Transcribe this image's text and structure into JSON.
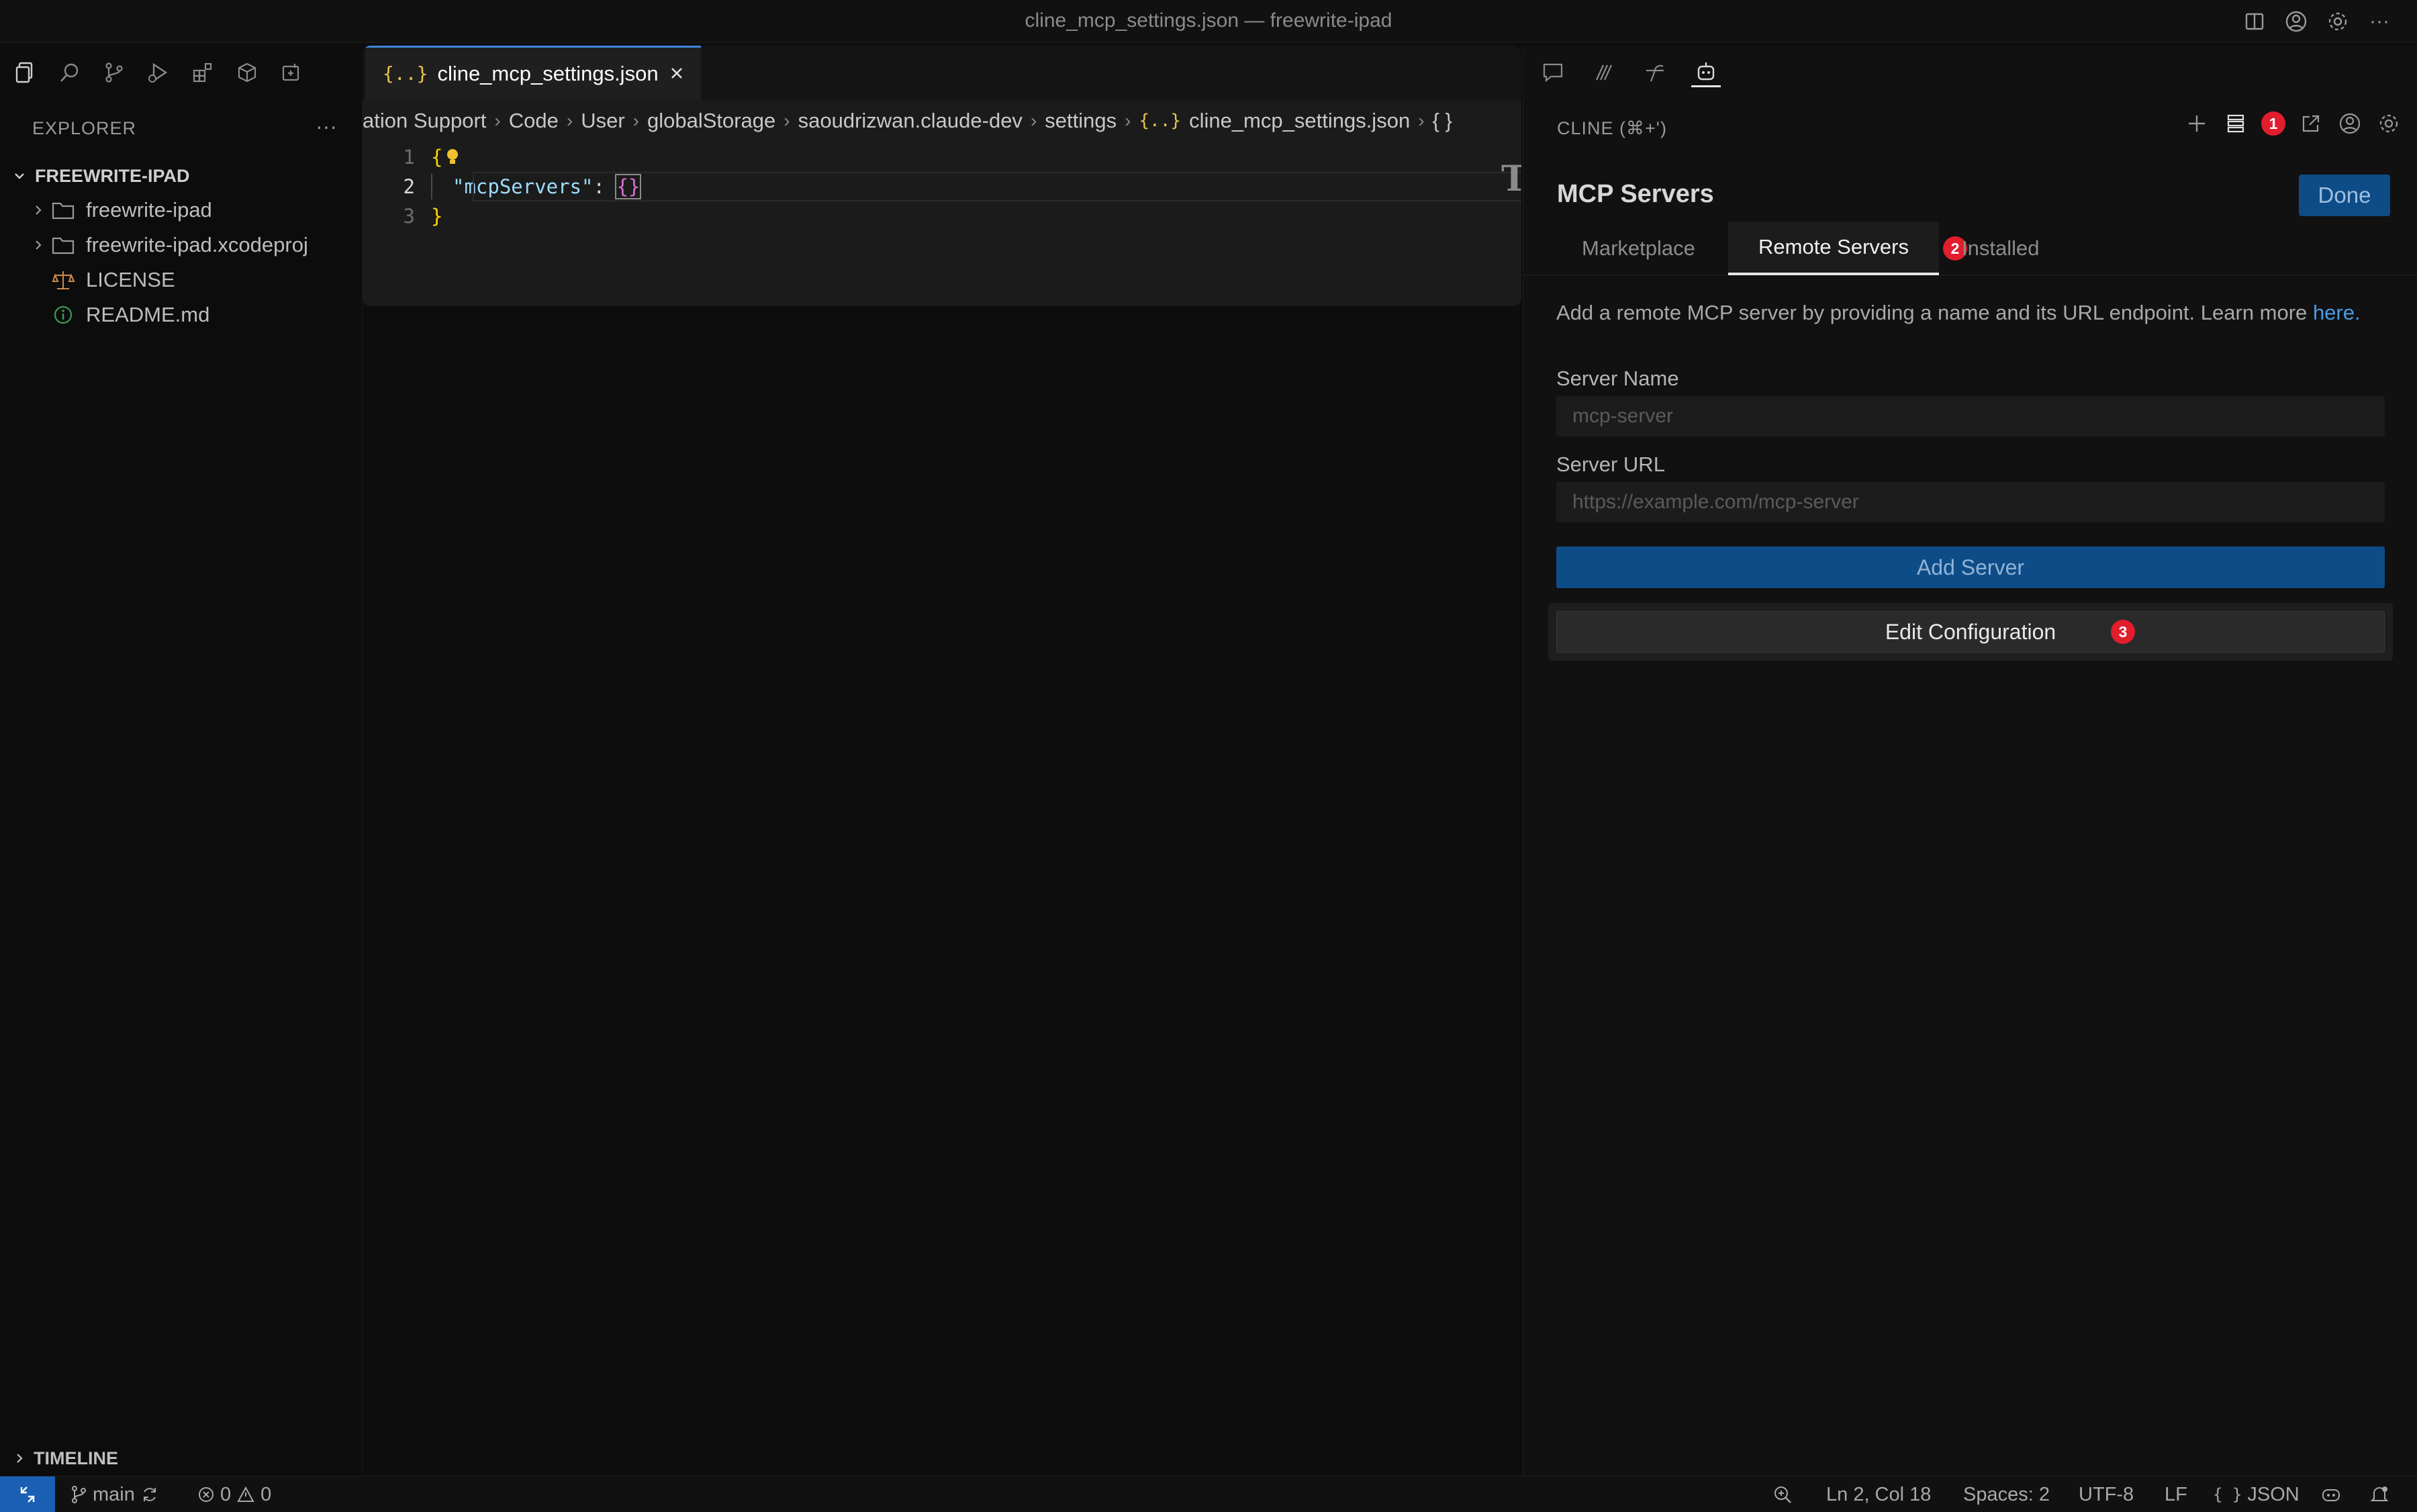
{
  "window": {
    "title": "cline_mcp_settings.json — freewrite-ipad"
  },
  "explorer": {
    "header": "EXPLORER",
    "more": "···",
    "workspace": "FREEWRITE-IPAD",
    "items": [
      {
        "label": "freewrite-ipad",
        "type": "folder"
      },
      {
        "label": "freewrite-ipad.xcodeproj",
        "type": "folder"
      },
      {
        "label": "LICENSE",
        "type": "license"
      },
      {
        "label": "README.md",
        "type": "info"
      }
    ],
    "timeline": "TIMELINE"
  },
  "editor": {
    "tab": {
      "icon": "{..}",
      "label": "cline_mcp_settings.json"
    },
    "breadcrumb": [
      "ation Support",
      "Code",
      "User",
      "globalStorage",
      "saoudrizwan.claude-dev",
      "settings"
    ],
    "breadcrumb_file": "cline_mcp_settings.json",
    "breadcrumb_file_icon": "{..}",
    "breadcrumb_tail": "{ }",
    "lines": [
      {
        "num": "1",
        "open": "{"
      },
      {
        "num": "2",
        "key": "\"mcpServers\"",
        "colon": ": ",
        "value": "{}"
      },
      {
        "num": "3",
        "close": "}"
      }
    ],
    "minimap_glyph": "T"
  },
  "cline": {
    "header": "CLINE (⌘+')",
    "badge1": "1",
    "title": "MCP Servers",
    "done": "Done",
    "tabs": {
      "marketplace": "Marketplace",
      "remote": "Remote Servers",
      "installed": "Installed"
    },
    "badge2": "2",
    "description": "Add a remote MCP server by providing a name and its URL endpoint. Learn more",
    "description_link": "here.",
    "server_name_label": "Server Name",
    "server_name_placeholder": "mcp-server",
    "server_url_label": "Server URL",
    "server_url_placeholder": "https://example.com/mcp-server",
    "add_server": "Add Server",
    "edit_config": "Edit Configuration",
    "badge3": "3"
  },
  "status": {
    "branch": "main",
    "errors": "0",
    "warnings": "0",
    "position": "Ln 2, Col 18",
    "spaces": "Spaces: 2",
    "encoding": "UTF-8",
    "eol": "LF",
    "language": "JSON",
    "language_icon": "{ }"
  },
  "colors": {
    "accent": "#0e4c87",
    "badge": "#e11d2e",
    "link": "#4a9be6",
    "statusRemote": "#1a5fb4"
  }
}
